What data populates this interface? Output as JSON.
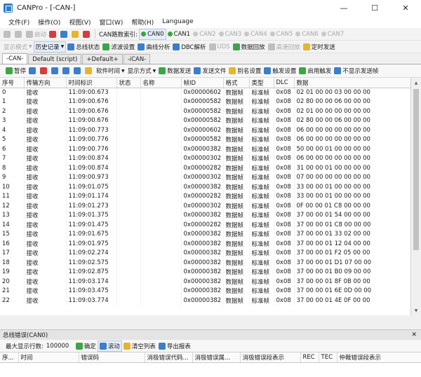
{
  "window": {
    "title": "CANPro - [-CAN-]",
    "minimize": "—",
    "maximize": "☐",
    "close": "✕"
  },
  "menu": [
    {
      "label": "文件(F)"
    },
    {
      "label": "操作(O)"
    },
    {
      "label": "视图(V)"
    },
    {
      "label": "窗口(W)"
    },
    {
      "label": "帮助(H)"
    },
    {
      "label": "Language"
    }
  ],
  "toolbar1": {
    "start_label": "启动",
    "can_index_label": "CAN路数索引:",
    "channels": [
      {
        "label": "CAN0",
        "active": true
      },
      {
        "label": "CAN1",
        "active": true
      },
      {
        "label": "CAN2",
        "active": false
      },
      {
        "label": "CAN3",
        "active": false
      },
      {
        "label": "CAN4",
        "active": false
      },
      {
        "label": "CAN5",
        "active": false
      },
      {
        "label": "CAN6",
        "active": false
      },
      {
        "label": "CAN7",
        "active": false
      }
    ]
  },
  "toolbar2": {
    "display_mode": "显示模式",
    "history": "历史记录",
    "bus_status": "总线状态",
    "filter": "滤波设置",
    "curve": "曲线分析",
    "dbc": "DBC解析",
    "uds": "UDS",
    "data_playback": "数据回放",
    "high_playback": "高速回放",
    "timed_send": "定时发送"
  },
  "tabs": [
    {
      "label": "-CAN-",
      "active": true
    },
    {
      "label": "Default (script)",
      "active": false
    },
    {
      "label": "+Default+",
      "active": false
    },
    {
      "label": "-iCAN-",
      "active": false
    }
  ],
  "toolbar3": {
    "pause": "暂停",
    "software_time": "软件时间",
    "display_mode": "显示方式",
    "data_send": "数据发送",
    "send_file": "发送文件",
    "alias": "别名设置",
    "trigger": "触发设置",
    "enable_trigger": "启用触发",
    "no_show_send": "不显示发送帧"
  },
  "grid": {
    "columns": [
      "序号",
      "传输方向",
      "时间标识",
      "状态",
      "名称",
      "帧ID",
      "格式",
      "类型",
      "DLC",
      "数据"
    ],
    "rows": [
      [
        "0",
        "接收",
        "11:09:00.673",
        "",
        "",
        "0x00000602",
        "数据帧",
        "标准帧",
        "0x08",
        "02 01 00 00 03 00 00 00"
      ],
      [
        "1",
        "接收",
        "11:09:00.676",
        "",
        "",
        "0x00000582",
        "数据帧",
        "标准帧",
        "0x08",
        "02 80 00 00 06 00 00 00"
      ],
      [
        "2",
        "接收",
        "11:09:00.676",
        "",
        "",
        "0x00000582",
        "数据帧",
        "标准帧",
        "0x08",
        "02 01 00 00 00 00 00 00"
      ],
      [
        "3",
        "接收",
        "11:09:00.676",
        "",
        "",
        "0x00000582",
        "数据帧",
        "标准帧",
        "0x08",
        "02 80 00 00 06 00 00 00"
      ],
      [
        "4",
        "接收",
        "11:09:00.773",
        "",
        "",
        "0x00000602",
        "数据帧",
        "标准帧",
        "0x08",
        "06 00 00 00 00 00 00 00"
      ],
      [
        "5",
        "接收",
        "11:09:00.776",
        "",
        "",
        "0x00000582",
        "数据帧",
        "标准帧",
        "0x08",
        "06 00 00 00 00 00 00 00"
      ],
      [
        "6",
        "接收",
        "11:09:00.776",
        "",
        "",
        "0x00000382",
        "数据帧",
        "标准帧",
        "0x08",
        "50 00 00 01 00 00 00 00"
      ],
      [
        "7",
        "接收",
        "11:09:00.874",
        "",
        "",
        "0x00000302",
        "数据帧",
        "标准帧",
        "0x08",
        "06 00 00 00 00 00 00 00"
      ],
      [
        "8",
        "接收",
        "11:09:00.874",
        "",
        "",
        "0x00000282",
        "数据帧",
        "标准帧",
        "0x08",
        "31 00 00 01 00 00 00 00"
      ],
      [
        "9",
        "接收",
        "11:09:00.973",
        "",
        "",
        "0x00000302",
        "数据帧",
        "标准帧",
        "0x08",
        "07 00 00 00 00 00 00 00"
      ],
      [
        "10",
        "接收",
        "11:09:01.075",
        "",
        "",
        "0x00000382",
        "数据帧",
        "标准帧",
        "0x08",
        "33 00 00 01 00 00 00 00"
      ],
      [
        "11",
        "接收",
        "11:09:01.174",
        "",
        "",
        "0x00000282",
        "数据帧",
        "标准帧",
        "0x08",
        "33 00 00 01 00 00 00 00"
      ],
      [
        "12",
        "接收",
        "11:09:01.273",
        "",
        "",
        "0x00000302",
        "数据帧",
        "标准帧",
        "0x08",
        "0F 00 00 01 C8 00 00 00"
      ],
      [
        "13",
        "接收",
        "11:09:01.375",
        "",
        "",
        "0x00000382",
        "数据帧",
        "标准帧",
        "0x08",
        "37 00 00 01 54 00 00 00"
      ],
      [
        "14",
        "接收",
        "11:09:01.475",
        "",
        "",
        "0x00000282",
        "数据帧",
        "标准帧",
        "0x08",
        "37 00 00 01 C8 00 00 00"
      ],
      [
        "15",
        "接收",
        "11:09:01.675",
        "",
        "",
        "0x00000382",
        "数据帧",
        "标准帧",
        "0x08",
        "37 00 00 01 33 02 00 00"
      ],
      [
        "16",
        "接收",
        "11:09:01.975",
        "",
        "",
        "0x00000382",
        "数据帧",
        "标准帧",
        "0x08",
        "37 00 00 01 12 04 00 00"
      ],
      [
        "17",
        "接收",
        "11:09:02.274",
        "",
        "",
        "0x00000382",
        "数据帧",
        "标准帧",
        "0x08",
        "37 00 00 01 F2 05 00 00"
      ],
      [
        "18",
        "接收",
        "11:09:02.575",
        "",
        "",
        "0x00000382",
        "数据帧",
        "标准帧",
        "0x08",
        "37 00 00 01 D1 07 00 00"
      ],
      [
        "19",
        "接收",
        "11:09:02.875",
        "",
        "",
        "0x00000382",
        "数据帧",
        "标准帧",
        "0x08",
        "37 00 00 01 B0 09 00 00"
      ],
      [
        "20",
        "接收",
        "11:09:03.174",
        "",
        "",
        "0x00000382",
        "数据帧",
        "标准帧",
        "0x08",
        "37 00 00 01 8F 0B 00 00"
      ],
      [
        "21",
        "接收",
        "11:09:03.475",
        "",
        "",
        "0x00000382",
        "数据帧",
        "标准帧",
        "0x08",
        "37 00 00 01 6E 0D 00 00"
      ],
      [
        "22",
        "接收",
        "11:09:03.774",
        "",
        "",
        "0x00000382",
        "数据帧",
        "标准帧",
        "0x08",
        "37 00 00 01 4E 0F 00 00"
      ]
    ]
  },
  "error_panel": {
    "title": "总线错误(CAN0)",
    "close": "✕",
    "max_rows_label": "最大显示行数:",
    "max_rows_value": "100000",
    "confirm": "确定",
    "scroll": "滚动",
    "clear": "清空列表",
    "export": "导出报表",
    "columns": [
      "序...",
      "时间",
      "错误码",
      "消极错误代码...",
      "消极错误属...",
      "消极错误段表示",
      "REC",
      "TEC",
      "仲裁错误段表示"
    ]
  }
}
